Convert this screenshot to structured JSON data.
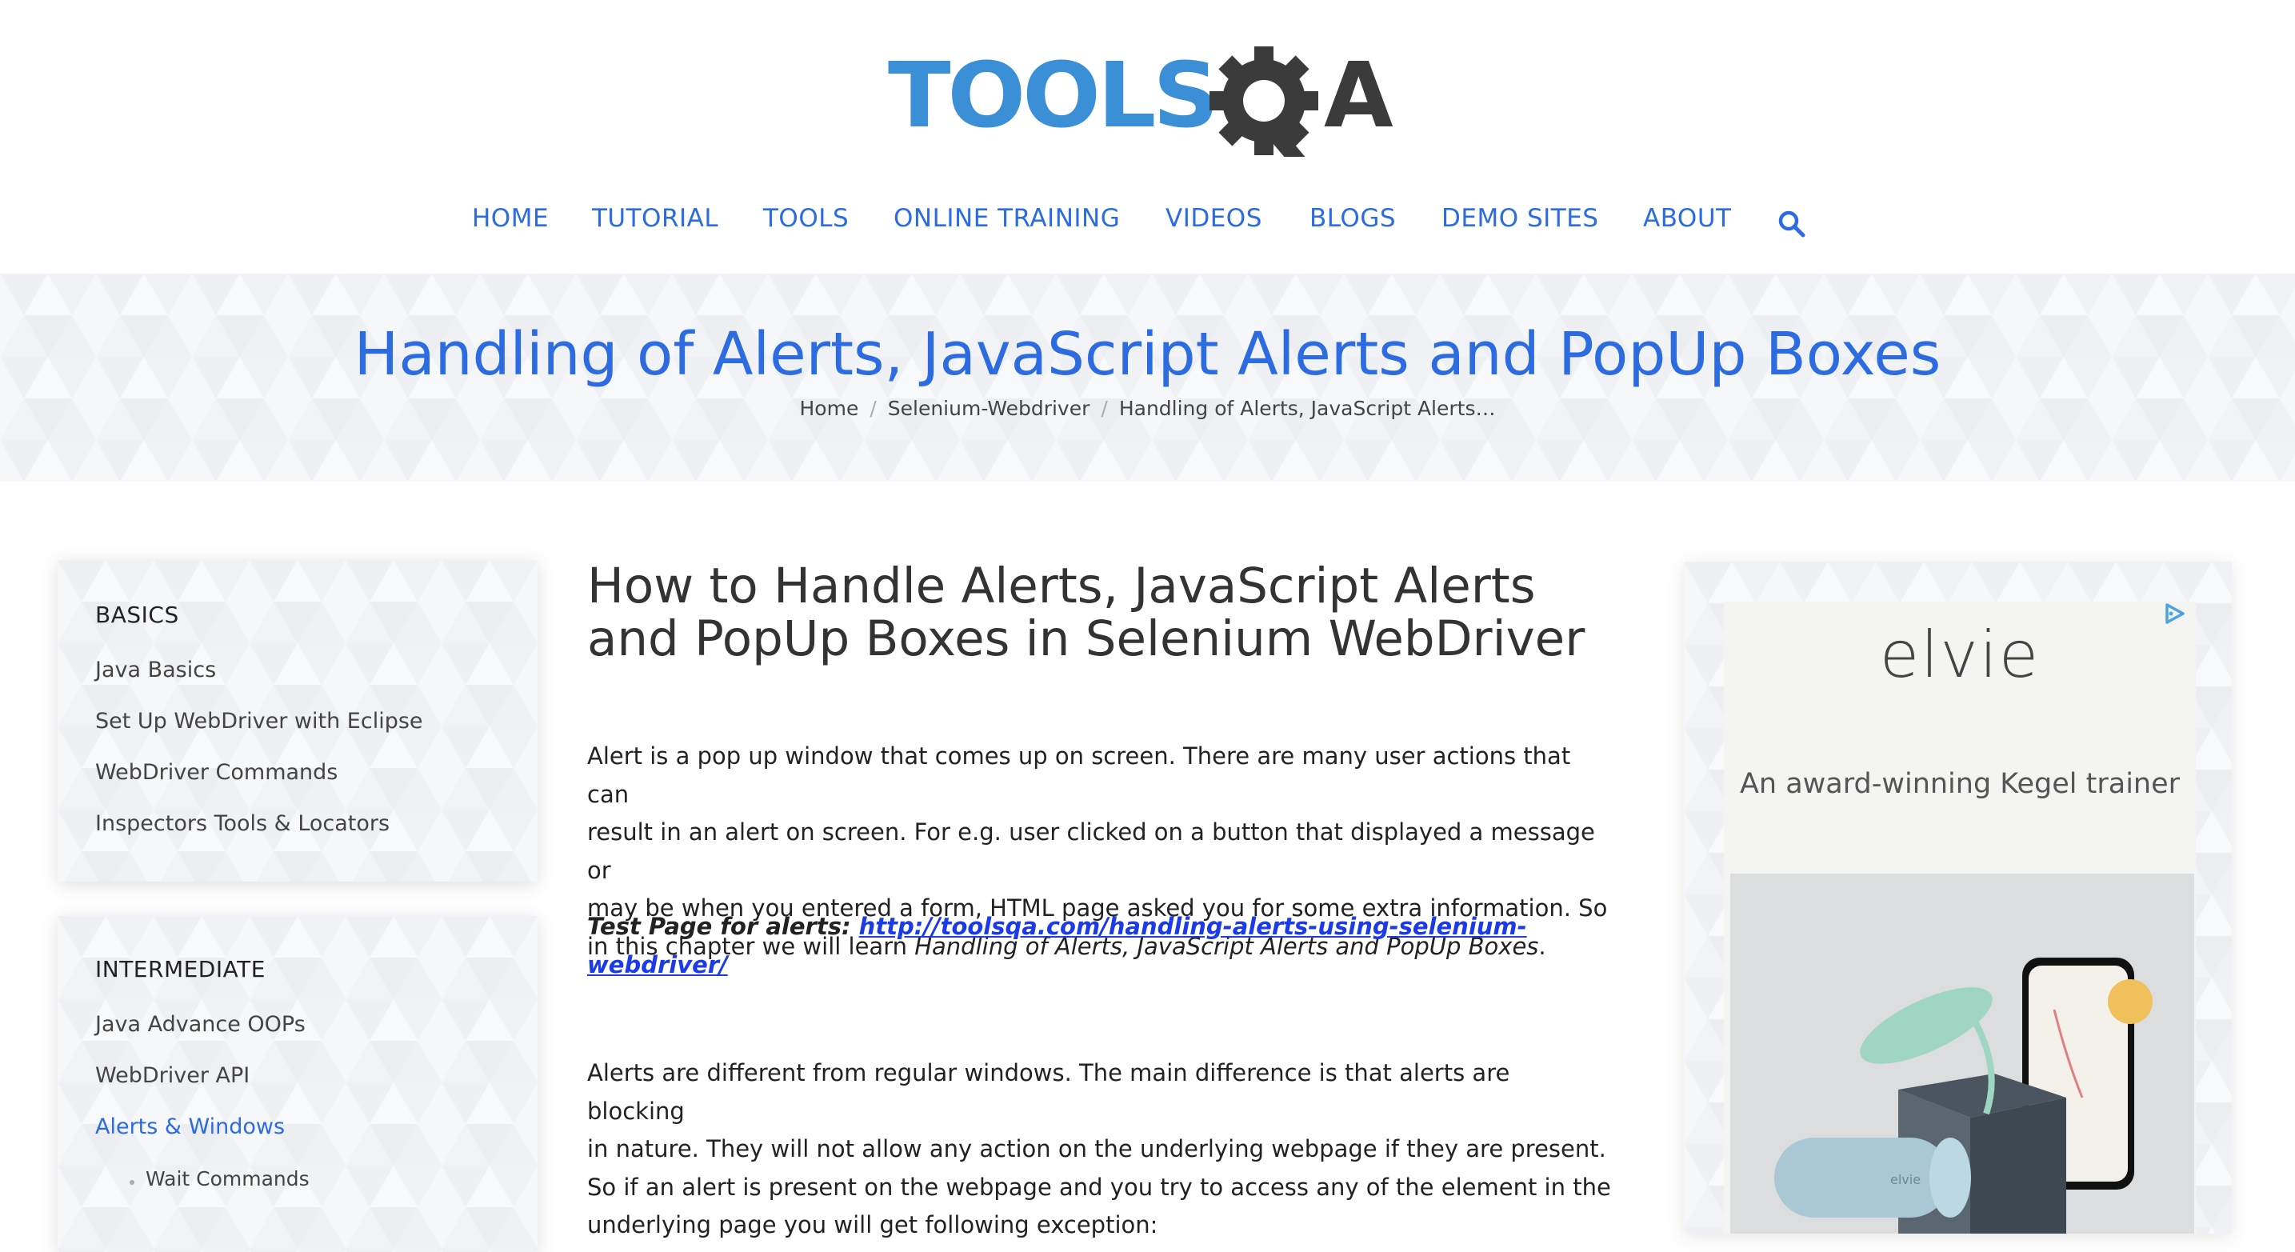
{
  "logo": {
    "text_left": "TOOLS",
    "text_right": "A",
    "gear_letter": "Q"
  },
  "nav": {
    "items": [
      "HOME",
      "TUTORIAL",
      "TOOLS",
      "ONLINE TRAINING",
      "VIDEOS",
      "BLOGS",
      "DEMO SITES",
      "ABOUT"
    ],
    "search_icon": "search-icon"
  },
  "hero": {
    "title": "Handling of Alerts, JavaScript Alerts and PopUp Boxes",
    "breadcrumb": [
      "Home",
      "Selenium-Webdriver",
      "Handling of Alerts, JavaScript Alerts…"
    ],
    "separator": "/"
  },
  "sidebar": {
    "basics": {
      "heading": "BASICS",
      "links": [
        "Java Basics",
        "Set Up WebDriver with Eclipse",
        "WebDriver Commands",
        "Inspectors Tools & Locators"
      ]
    },
    "intermediate": {
      "heading": "INTERMEDIATE",
      "links": [
        "Java Advance OOPs",
        "WebDriver API",
        "Alerts & Windows"
      ],
      "sublinks": [
        "Wait Commands"
      ]
    }
  },
  "article": {
    "title_line1": "How to Handle Alerts, JavaScript Alerts",
    "title_line2": "and PopUp Boxes in Selenium WebDriver",
    "p1_lines": [
      "Alert is a pop up window that comes up on screen. There are many user actions that can",
      "result in an alert on screen. For e.g. user clicked on a button that displayed a message or",
      "may be when you entered a form, HTML page asked you for some extra information. So"
    ],
    "p1_last_prefix": "in this chapter we will learn ",
    "p1_last_italic": "Handling of Alerts, JavaScript Alerts and PopUp Boxes",
    "p1_last_suffix": ".",
    "test_label": "Test Page for alerts: ",
    "test_link_line1": "http://toolsqa.com/handling-alerts-using-selenium-",
    "test_link_line2": "webdriver/",
    "p2_lines": [
      "Alerts are different from regular windows. The main difference is that alerts are blocking",
      "in nature. They will not allow any action on the underlying webpage if they are present.",
      "So if an alert is present on the webpage and you try to access any of the element in the",
      "underlying page you will get following exception:"
    ]
  },
  "ad": {
    "brand": "elvie",
    "tagline": "An award-winning Kegel trainer",
    "choices_icon": "ad-choices-icon",
    "product_text": "elvie"
  },
  "colors": {
    "accent": "#2c6be0",
    "logo_blue": "#3a8fd6",
    "logo_dark": "#3b3b3b",
    "link": "#1a3be6"
  }
}
